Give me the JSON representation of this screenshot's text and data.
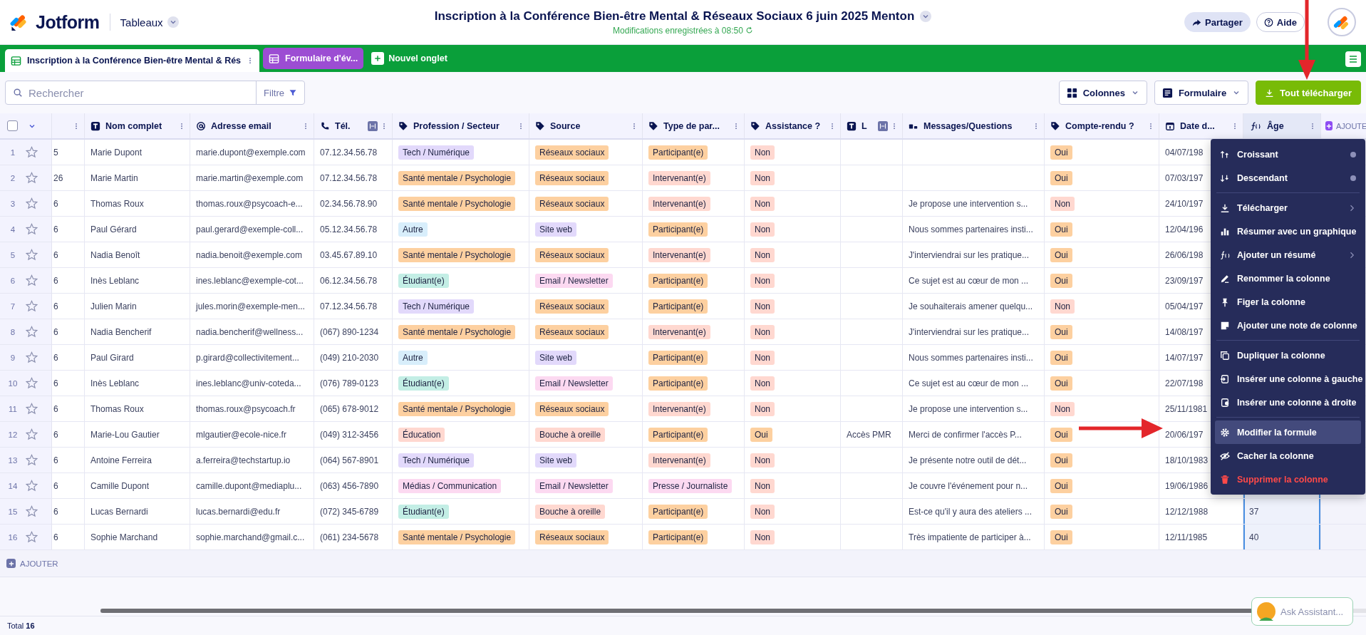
{
  "app": {
    "logo_text": "Jotform",
    "section": "Tableaux"
  },
  "document": {
    "title": "Inscription à la Conférence Bien-être Mental & Réseaux Sociaux 6 juin 2025 Menton",
    "status": "Modifications enregistrées à 08:50"
  },
  "header_actions": [
    {
      "label": "Partager",
      "kind": "share"
    },
    {
      "label": "Aide",
      "kind": "help"
    }
  ],
  "tabs": [
    {
      "label": "Inscription à la Conférence Bien-être Mental & Rés",
      "selected": true
    },
    {
      "label": "Formulaire d'év...",
      "selected": false
    }
  ],
  "new_tab": "Nouvel onglet",
  "search": {
    "placeholder": "Rechercher"
  },
  "filter": "Filtre",
  "toolbar_buttons": [
    {
      "label": "Colonnes",
      "kind": "columns"
    },
    {
      "label": "Formulaire",
      "kind": "form"
    },
    {
      "label": "Tout télécharger",
      "kind": "download"
    }
  ],
  "table": {
    "select_all": {
      "checked": false
    },
    "columns": [
      {
        "kind": "cut",
        "selected": false,
        "resize": false
      },
      {
        "label": "Nom complet",
        "kind": "text",
        "selected": false,
        "resize": false
      },
      {
        "label": "Adresse email",
        "kind": "email",
        "selected": false,
        "resize": false
      },
      {
        "label": "Tél.",
        "kind": "phone",
        "selected": false,
        "resize": true
      },
      {
        "label": "Profession / Secteur",
        "kind": "tag",
        "selected": false,
        "resize": false
      },
      {
        "label": "Source",
        "kind": "tag",
        "selected": false,
        "resize": false
      },
      {
        "label": "Type de par...",
        "kind": "tag",
        "selected": false,
        "resize": false
      },
      {
        "label": "Assistance ?",
        "kind": "tag",
        "selected": false,
        "resize": false
      },
      {
        "label": "L",
        "kind": "text",
        "selected": false,
        "resize": true
      },
      {
        "label": "Messages/Questions",
        "kind": "longtext",
        "selected": false,
        "resize": false
      },
      {
        "label": "Compte-rendu ?",
        "kind": "tag",
        "selected": false,
        "resize": false
      },
      {
        "label": "Date d...",
        "kind": "date",
        "selected": false,
        "resize": false
      },
      {
        "label": "Âge",
        "kind": "formula",
        "selected": true,
        "resize": false
      }
    ],
    "add_column": "AJOUTE",
    "rows": [
      {
        "number": "1",
        "starred": false,
        "cells": [
          "5",
          "Marie Dupont",
          "marie.dupont@exemple.com",
          "07.12.34.56.78",
          {
            "text": "Tech / Numérique",
            "color": "#e2d9fb"
          },
          {
            "text": "Réseaux sociaux",
            "color": "#fdd0a0"
          },
          {
            "text": "Participant(e)",
            "color": "#fdd0a0"
          },
          {
            "text": "Non",
            "color": "#ffd8d0"
          },
          null,
          null,
          {
            "text": "Oui",
            "color": "#fdd0a0"
          },
          "04/07/198",
          null
        ]
      },
      {
        "number": "2",
        "starred": false,
        "cells": [
          "26",
          "Marie Martin",
          "marie.martin@exemple.com",
          "07.12.34.56.78",
          {
            "text": "Santé mentale / Psychologie",
            "color": "#fdd0a0"
          },
          {
            "text": "Réseaux sociaux",
            "color": "#fdd0a0"
          },
          {
            "text": "Intervenant(e)",
            "color": "#ffd8d0"
          },
          {
            "text": "Non",
            "color": "#ffd8d0"
          },
          null,
          null,
          {
            "text": "Oui",
            "color": "#fdd0a0"
          },
          "07/03/197",
          null
        ]
      },
      {
        "number": "3",
        "starred": false,
        "cells": [
          "6",
          "Thomas Roux",
          "thomas.roux@psycoach-e...",
          "02.34.56.78.90",
          {
            "text": "Santé mentale / Psychologie",
            "color": "#fdd0a0"
          },
          {
            "text": "Réseaux sociaux",
            "color": "#fdd0a0"
          },
          {
            "text": "Intervenant(e)",
            "color": "#ffd8d0"
          },
          {
            "text": "Non",
            "color": "#ffd8d0"
          },
          null,
          "Je propose une intervention s...",
          {
            "text": "Non",
            "color": "#ffd8d0"
          },
          "24/10/197",
          null
        ]
      },
      {
        "number": "4",
        "starred": false,
        "cells": [
          "6",
          "Paul Gérard",
          "paul.gerard@exemple-coll...",
          "05.12.34.56.78",
          {
            "text": "Autre",
            "color": "#d8eefb"
          },
          {
            "text": "Site web",
            "color": "#e2d9fb"
          },
          {
            "text": "Participant(e)",
            "color": "#fdd0a0"
          },
          {
            "text": "Non",
            "color": "#ffd8d0"
          },
          null,
          "Nous sommes partenaires insti...",
          {
            "text": "Oui",
            "color": "#fdd0a0"
          },
          "12/04/196",
          null
        ]
      },
      {
        "number": "5",
        "starred": false,
        "cells": [
          "6",
          "Nadia Benoît",
          "nadia.benoit@exemple.com",
          "03.45.67.89.10",
          {
            "text": "Santé mentale / Psychologie",
            "color": "#fdd0a0"
          },
          {
            "text": "Réseaux sociaux",
            "color": "#fdd0a0"
          },
          {
            "text": "Intervenant(e)",
            "color": "#ffd8d0"
          },
          {
            "text": "Non",
            "color": "#ffd8d0"
          },
          null,
          "J'interviendrai sur les pratique...",
          {
            "text": "Oui",
            "color": "#fdd0a0"
          },
          "26/06/198",
          null
        ]
      },
      {
        "number": "6",
        "starred": false,
        "cells": [
          "6",
          "Inès Leblanc",
          "ines.leblanc@exemple-cot...",
          "06.12.34.56.78",
          {
            "text": "Étudiant(e)",
            "color": "#c3eee5"
          },
          {
            "text": "Email / Newsletter",
            "color": "#fcd9f1"
          },
          {
            "text": "Participant(e)",
            "color": "#fdd0a0"
          },
          {
            "text": "Non",
            "color": "#ffd8d0"
          },
          null,
          "Ce sujet est au cœur de mon ...",
          {
            "text": "Oui",
            "color": "#fdd0a0"
          },
          "23/09/197",
          null
        ]
      },
      {
        "number": "7",
        "starred": false,
        "cells": [
          "6",
          "Julien Marin",
          "jules.morin@exemple-men...",
          "07.12.34.56.78",
          {
            "text": "Tech / Numérique",
            "color": "#e2d9fb"
          },
          {
            "text": "Réseaux sociaux",
            "color": "#fdd0a0"
          },
          {
            "text": "Participant(e)",
            "color": "#fdd0a0"
          },
          {
            "text": "Non",
            "color": "#ffd8d0"
          },
          null,
          "Je souhaiterais amener quelqu...",
          {
            "text": "Non",
            "color": "#ffd8d0"
          },
          "05/04/197",
          null
        ]
      },
      {
        "number": "8",
        "starred": false,
        "cells": [
          "6",
          "Nadia Bencherif",
          "nadia.bencherif@wellness...",
          "(067) 890-1234",
          {
            "text": "Santé mentale / Psychologie",
            "color": "#fdd0a0"
          },
          {
            "text": "Réseaux sociaux",
            "color": "#fdd0a0"
          },
          {
            "text": "Intervenant(e)",
            "color": "#ffd8d0"
          },
          {
            "text": "Non",
            "color": "#ffd8d0"
          },
          null,
          "J'interviendrai sur les pratique...",
          {
            "text": "Oui",
            "color": "#fdd0a0"
          },
          "14/08/197",
          null
        ]
      },
      {
        "number": "9",
        "starred": false,
        "cells": [
          "6",
          "Paul Girard",
          "p.girard@collectivitement...",
          "(049) 210-2030",
          {
            "text": "Autre",
            "color": "#d8eefb"
          },
          {
            "text": "Site web",
            "color": "#e2d9fb"
          },
          {
            "text": "Participant(e)",
            "color": "#fdd0a0"
          },
          {
            "text": "Non",
            "color": "#ffd8d0"
          },
          null,
          "Nous sommes partenaires insti...",
          {
            "text": "Oui",
            "color": "#fdd0a0"
          },
          "14/07/197",
          null
        ]
      },
      {
        "number": "10",
        "starred": false,
        "cells": [
          "6",
          "Inès Leblanc",
          "ines.leblanc@univ-coteda...",
          "(076) 789-0123",
          {
            "text": "Étudiant(e)",
            "color": "#c3eee5"
          },
          {
            "text": "Email / Newsletter",
            "color": "#fcd9f1"
          },
          {
            "text": "Participant(e)",
            "color": "#fdd0a0"
          },
          {
            "text": "Non",
            "color": "#ffd8d0"
          },
          null,
          "Ce sujet est au cœur de mon ...",
          {
            "text": "Oui",
            "color": "#fdd0a0"
          },
          "22/07/198",
          null
        ]
      },
      {
        "number": "11",
        "starred": false,
        "cells": [
          "6",
          "Thomas Roux",
          "thomas.roux@psycoach.fr",
          "(065) 678-9012",
          {
            "text": "Santé mentale / Psychologie",
            "color": "#fdd0a0"
          },
          {
            "text": "Réseaux sociaux",
            "color": "#fdd0a0"
          },
          {
            "text": "Intervenant(e)",
            "color": "#ffd8d0"
          },
          {
            "text": "Non",
            "color": "#ffd8d0"
          },
          null,
          "Je propose une intervention s...",
          {
            "text": "Non",
            "color": "#ffd8d0"
          },
          "25/11/1981",
          null
        ]
      },
      {
        "number": "12",
        "starred": false,
        "cells": [
          "6",
          "Marie-Lou Gautier",
          "mlgautier@ecole-nice.fr",
          "(049) 312-3456",
          {
            "text": "Éducation",
            "color": "#ffd8d0"
          },
          {
            "text": "Bouche à oreille",
            "color": "#ffd8d0"
          },
          {
            "text": "Participant(e)",
            "color": "#fdd0a0"
          },
          {
            "text": "Oui",
            "color": "#fdd0a0"
          },
          "Accès PMR",
          "Merci de confirmer l'accès P...",
          {
            "text": "Oui",
            "color": "#fdd0a0"
          },
          "20/06/197",
          null
        ]
      },
      {
        "number": "13",
        "starred": false,
        "cells": [
          "6",
          "Antoine Ferreira",
          "a.ferreira@techstartup.io",
          "(064) 567-8901",
          {
            "text": "Tech / Numérique",
            "color": "#e2d9fb"
          },
          {
            "text": "Site web",
            "color": "#e2d9fb"
          },
          {
            "text": "Intervenant(e)",
            "color": "#ffd8d0"
          },
          {
            "text": "Non",
            "color": "#ffd8d0"
          },
          null,
          "Je présente notre outil de dét...",
          {
            "text": "Oui",
            "color": "#fdd0a0"
          },
          "18/10/1983",
          null
        ]
      },
      {
        "number": "14",
        "starred": false,
        "cells": [
          "6",
          "Camille Dupont",
          "camille.dupont@mediaplu...",
          "(063) 456-7890",
          {
            "text": "Médias / Communication",
            "color": "#fcd9f1"
          },
          {
            "text": "Email / Newsletter",
            "color": "#fcd9f1"
          },
          {
            "text": "Presse / Journaliste",
            "color": "#fcd9f1"
          },
          {
            "text": "Non",
            "color": "#ffd8d0"
          },
          null,
          "Je couvre l'événement pour n...",
          {
            "text": "Oui",
            "color": "#fdd0a0"
          },
          "19/06/1986",
          null
        ]
      },
      {
        "number": "15",
        "starred": false,
        "cells": [
          "6",
          "Lucas Bernardi",
          "lucas.bernardi@edu.fr",
          "(072) 345-6789",
          {
            "text": "Étudiant(e)",
            "color": "#c3eee5"
          },
          {
            "text": "Bouche à oreille",
            "color": "#ffd8d0"
          },
          {
            "text": "Participant(e)",
            "color": "#fdd0a0"
          },
          {
            "text": "Non",
            "color": "#ffd8d0"
          },
          null,
          "Est-ce qu'il y aura des ateliers ...",
          {
            "text": "Oui",
            "color": "#fdd0a0"
          },
          "12/12/1988",
          "37"
        ]
      },
      {
        "number": "16",
        "starred": false,
        "cells": [
          "6",
          "Sophie Marchand",
          "sophie.marchand@gmail.c...",
          "(061) 234-5678",
          {
            "text": "Santé mentale / Psychologie",
            "color": "#fdd0a0"
          },
          {
            "text": "Réseaux sociaux",
            "color": "#fdd0a0"
          },
          {
            "text": "Participant(e)",
            "color": "#fdd0a0"
          },
          {
            "text": "Non",
            "color": "#ffd8d0"
          },
          null,
          "Très impatiente de participer à...",
          {
            "text": "Oui",
            "color": "#fdd0a0"
          },
          "12/11/1985",
          "40"
        ]
      }
    ],
    "add_row": "AJOUTER"
  },
  "column_menu": {
    "groups": [
      [
        {
          "label": "Croissant",
          "kind": "sort",
          "selected": false,
          "submenu": false
        },
        {
          "label": "Descendant",
          "kind": "sort",
          "selected": false,
          "submenu": false
        }
      ],
      [
        {
          "label": "Télécharger",
          "kind": "normal",
          "selected": false,
          "submenu": true
        },
        {
          "label": "Résumer avec un graphique",
          "kind": "normal",
          "selected": false,
          "submenu": false
        },
        {
          "label": "Ajouter un résumé",
          "kind": "normal",
          "selected": false,
          "submenu": true
        },
        {
          "label": "Renommer la colonne",
          "kind": "normal",
          "selected": false,
          "submenu": false
        },
        {
          "label": "Figer la colonne",
          "kind": "normal",
          "selected": false,
          "submenu": false
        },
        {
          "label": "Ajouter une note de colonne",
          "kind": "normal",
          "selected": false,
          "submenu": false
        }
      ],
      [
        {
          "label": "Dupliquer la colonne",
          "kind": "normal",
          "selected": false,
          "submenu": false
        },
        {
          "label": "Insérer une colonne à gauche",
          "kind": "normal",
          "selected": false,
          "submenu": false
        },
        {
          "label": "Insérer une colonne à droite",
          "kind": "normal",
          "selected": false,
          "submenu": false
        }
      ],
      [
        {
          "label": "Modifier la formule",
          "kind": "normal",
          "selected": true,
          "submenu": false
        },
        {
          "label": "Cacher la colonne",
          "kind": "normal",
          "selected": false,
          "submenu": false
        },
        {
          "label": "Supprimer la colonne",
          "kind": "danger",
          "selected": false,
          "submenu": false
        }
      ]
    ]
  },
  "footer": {
    "total": "Total **16**"
  },
  "assistant": {
    "label": "Ask Assistant..."
  },
  "annotations": [
    {
      "kind": "down-arrow"
    },
    {
      "kind": "right-arrow"
    }
  ]
}
